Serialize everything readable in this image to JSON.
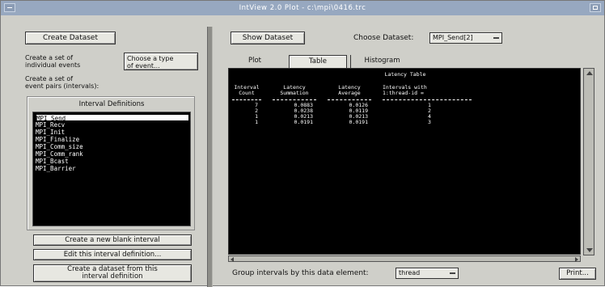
{
  "window": {
    "title": "IntView 2.0 Plot - c:\\mpi\\0416.trc"
  },
  "left": {
    "create_dataset_label": "Create Dataset",
    "individual_events_text": "Create a set of\nindividual events",
    "choose_type_text": "Choose a type\nof event...",
    "event_pairs_text": "Create a set of\nevent pairs (intervals):",
    "interval_definitions_title": "Interval Definitions",
    "intervals": [
      "MPI_Send",
      "MPI_Recv",
      "MPI_Init",
      "MPI_Finalize",
      "MPI_Comm_size",
      "MPI_Comm_rank",
      "MPI_Bcast",
      "MPI_Barrier"
    ],
    "selected_interval": 0,
    "create_blank_label": "Create a new blank interval",
    "edit_label": "Edit this interval definition...",
    "create_from_def_label": "Create a dataset from this\ninterval definition"
  },
  "right": {
    "show_dataset_label": "Show Dataset",
    "choose_dataset_label": "Choose Dataset:",
    "dataset_value": "MPI_Send[2]",
    "tabs": [
      {
        "label": "Plot",
        "active": false
      },
      {
        "label": "Table",
        "active": true
      },
      {
        "label": "Histogram",
        "active": false
      }
    ],
    "table": {
      "title": "Latency Table",
      "headers": [
        "Interval\nCount",
        "Latency\nSummation",
        "Latency\nAverage",
        "Intervals with\n1:thread-id ="
      ],
      "rows": [
        [
          "7",
          "0.0883",
          "0.0126",
          "1"
        ],
        [
          "2",
          "0.0238",
          "0.0119",
          "2"
        ],
        [
          "1",
          "0.0213",
          "0.0213",
          "4"
        ],
        [
          "1",
          "0.0191",
          "0.0191",
          "3"
        ]
      ]
    },
    "group_label": "Group intervals by this data element:",
    "group_value": "thread",
    "print_label": "Print..."
  }
}
